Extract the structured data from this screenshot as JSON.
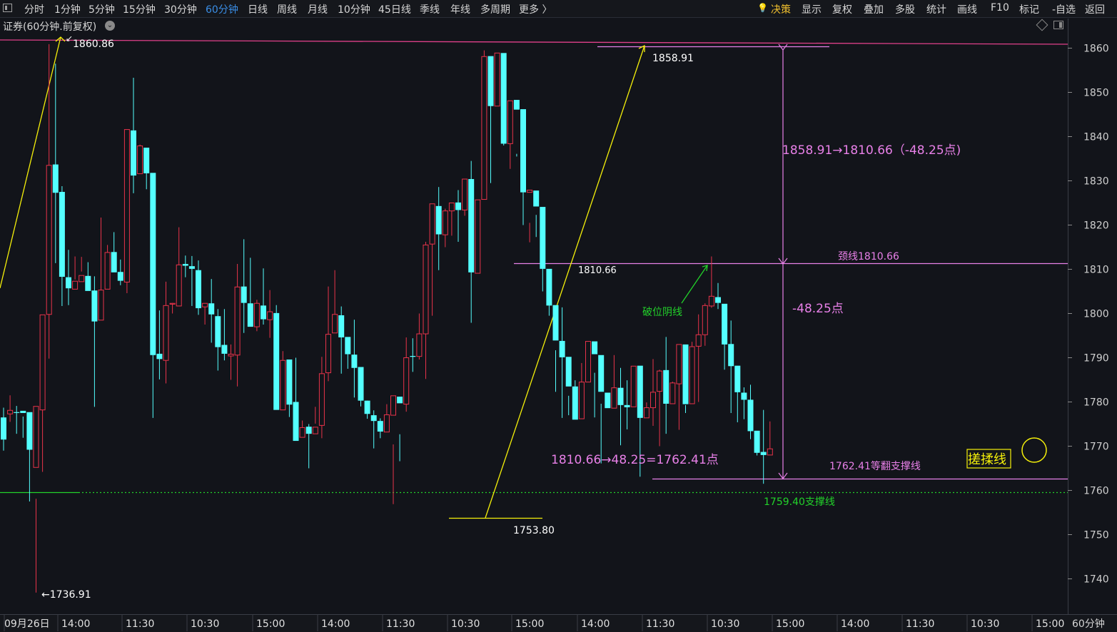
{
  "toolbar": {
    "periods": [
      "分时",
      "1分钟",
      "5分钟",
      "15分钟",
      "30分钟",
      "60分钟",
      "日线",
      "周线",
      "月线",
      "10分钟",
      "45日线",
      "季线",
      "年线",
      "多周期",
      "更多 〉"
    ],
    "active_period": "60分钟",
    "right_items": [
      "决策",
      "显示",
      "复权",
      "叠加",
      "多股",
      "统计",
      "画线",
      "F10",
      "标记",
      "-自选",
      "返回"
    ]
  },
  "subtitle": "证券(60分钟.前复权)",
  "chart_data": {
    "type": "candlestick",
    "ylim": [
      1734,
      1865
    ],
    "yticks": [
      1740,
      1750,
      1760,
      1770,
      1780,
      1790,
      1800,
      1810,
      1820,
      1830,
      1840,
      1850,
      1860
    ],
    "xticks": [
      "09月26日",
      "14:00",
      "11:30",
      "10:30",
      "15:00",
      "14:00",
      "11:30",
      "10:30",
      "15:00",
      "14:00",
      "11:30",
      "10:30",
      "15:00",
      "14:00",
      "11:30",
      "10:30",
      "15:00"
    ],
    "period_label": "60分钟",
    "up_color": "#e8334a",
    "down_color": "#54ffff",
    "candles": [
      [
        1776.5,
        1771.5,
        1778.7,
        1769.0
      ],
      [
        1777.3,
        1778.1,
        1781.5,
        1775.5
      ],
      [
        1777.7,
        1777.6,
        1779.1,
        1772.8
      ],
      [
        1778.0,
        1777.5,
        1776.7,
        1771.9
      ],
      [
        1777.7,
        1769.2,
        1777.0,
        1757.5
      ],
      [
        1765.2,
        1779.0,
        1736.9,
        1758.1
      ],
      [
        1778.2,
        1799.7,
        1764.2,
        1789.3
      ],
      [
        1799.8,
        1833.5,
        1789.8,
        1860.9
      ],
      [
        1833.7,
        1827.3,
        1811.4,
        1856.5
      ],
      [
        1827.5,
        1808.3,
        1801.7,
        1828.8
      ],
      [
        1808.2,
        1805.7,
        1801.9,
        1814.4
      ],
      [
        1805.5,
        1807.3,
        1807.7,
        1812.9
      ],
      [
        1807.2,
        1808.6,
        1809.5,
        1812.8
      ],
      [
        1808.5,
        1805.1,
        1806.1,
        1811.6
      ],
      [
        1805.2,
        1798.2,
        1778.9,
        1808.4
      ],
      [
        1798.5,
        1805.3,
        1804.4,
        1821.7
      ],
      [
        1805.5,
        1813.8,
        1810.9,
        1815.5
      ],
      [
        1813.9,
        1809.3,
        1809.8,
        1818.4
      ],
      [
        1809.4,
        1807.4,
        1806.4,
        1812.2
      ],
      [
        1807.1,
        1841.6,
        1804.6,
        1839.7
      ],
      [
        1841.4,
        1831.2,
        1827.2,
        1853.3
      ],
      [
        1831.6,
        1837.9,
        1831.7,
        1838.2
      ],
      [
        1837.5,
        1831.7,
        1828.1,
        1836.2
      ],
      [
        1831.8,
        1790.6,
        1776.4,
        1822.7
      ],
      [
        1790.9,
        1789.7,
        1785.1,
        1800.7
      ],
      [
        1789.4,
        1801.8,
        1784.2,
        1807.2
      ],
      [
        1802.3,
        1802.3,
        1800.0,
        1802.4
      ],
      [
        1801.7,
        1811.0,
        1804.2,
        1819.5
      ],
      [
        1811.2,
        1810.8,
        1808.2,
        1813.1
      ],
      [
        1810.7,
        1810.1,
        1801.7,
        1813.0
      ],
      [
        1809.8,
        1801.2,
        1799.7,
        1812.0
      ],
      [
        1801.5,
        1802.3,
        1797.5,
        1801.9
      ],
      [
        1802.3,
        1799.8,
        1793.4,
        1807.8
      ],
      [
        1799.4,
        1792.4,
        1787.1,
        1801.0
      ],
      [
        1792.9,
        1790.9,
        1789.4,
        1801.0
      ],
      [
        1790.4,
        1790.8,
        1785.0,
        1793.0
      ],
      [
        1790.6,
        1806.0,
        1783.5,
        1811.2
      ],
      [
        1806.1,
        1802.4,
        1795.6,
        1816.8
      ],
      [
        1802.3,
        1797.0,
        1797.4,
        1812.6
      ],
      [
        1797.0,
        1802.3,
        1796.0,
        1803.1
      ],
      [
        1801.8,
        1798.7,
        1797.5,
        1810.2
      ],
      [
        1798.6,
        1800.4,
        1794.5,
        1805.3
      ],
      [
        1800.1,
        1778.2,
        1784.4,
        1801.9
      ],
      [
        1778.2,
        1789.4,
        1783.6,
        1791.5
      ],
      [
        1789.6,
        1779.4,
        1776.6,
        1788.0
      ],
      [
        1780.0,
        1771.2,
        1771.9,
        1790.0
      ],
      [
        1772.0,
        1774.2,
        1773.3,
        1775.8
      ],
      [
        1774.4,
        1772.8,
        1775.0,
        1765.0
      ],
      [
        1772.8,
        1774.3,
        1775.1,
        1778.9
      ],
      [
        1774.7,
        1786.4,
        1771.8,
        1790.2
      ],
      [
        1786.6,
        1795.3,
        1784.7,
        1806.1
      ],
      [
        1795.6,
        1799.8,
        1798.3,
        1809.8
      ],
      [
        1799.6,
        1794.6,
        1786.4,
        1801.6
      ],
      [
        1794.7,
        1790.8,
        1787.5,
        1792.7
      ],
      [
        1790.7,
        1787.7,
        1781.0,
        1798.6
      ],
      [
        1787.9,
        1780.3,
        1779.0,
        1783.0
      ],
      [
        1780.3,
        1777.3,
        1776.2,
        1780.3
      ],
      [
        1777.0,
        1775.7,
        1769.5,
        1778.1
      ],
      [
        1775.7,
        1773.3,
        1771.8,
        1776.3
      ],
      [
        1773.2,
        1777.1,
        1774.3,
        1779.5
      ],
      [
        1777.0,
        1781.4,
        1756.9,
        1770.4
      ],
      [
        1781.2,
        1779.7,
        1766.6,
        1772.7
      ],
      [
        1779.5,
        1790.0,
        1777.8,
        1794.6
      ],
      [
        1790.4,
        1790.2,
        1786.8,
        1794.4
      ],
      [
        1790.3,
        1795.4,
        1789.6,
        1800.0
      ],
      [
        1795.4,
        1815.5,
        1785.2,
        1816.2
      ],
      [
        1815.7,
        1824.8,
        1799.5,
        1822.8
      ],
      [
        1824.3,
        1817.9,
        1809.8,
        1828.6
      ],
      [
        1817.8,
        1823.2,
        1815.0,
        1823.7
      ],
      [
        1823.2,
        1825.0,
        1817.6,
        1825.0
      ],
      [
        1825.1,
        1823.4,
        1816.2,
        1827.9
      ],
      [
        1823.4,
        1830.4,
        1822.1,
        1829.0
      ],
      [
        1830.4,
        1809.3,
        1797.9,
        1834.5
      ],
      [
        1809.1,
        1825.7,
        1810.7,
        1824.7
      ],
      [
        1825.8,
        1858.1,
        1859.5,
        1835.8
      ],
      [
        1858.2,
        1846.9,
        1829.5,
        1849.6
      ],
      [
        1846.9,
        1858.9,
        1858.9,
        1855.2
      ],
      [
        1858.9,
        1838.4,
        1838.0,
        1857.0
      ],
      [
        1838.4,
        1848.1,
        1847.0,
        1832.7
      ],
      [
        1848.3,
        1846.1,
        1835.5,
        1836.1
      ],
      [
        1846.2,
        1827.4,
        1820.0,
        1843.1
      ],
      [
        1827.4,
        1827.9,
        1820.5,
        1816.1
      ],
      [
        1827.8,
        1824.2,
        1822.3,
        1817.3
      ],
      [
        1824.1,
        1810.1,
        1805.0,
        1812.0
      ],
      [
        1810.1,
        1801.8,
        1799.5,
        1807.2
      ],
      [
        1801.9,
        1793.9,
        1782.3,
        1791.7
      ],
      [
        1793.8,
        1790.1,
        1776.4,
        1801.4
      ],
      [
        1790.2,
        1783.5,
        1781.4,
        1777.0
      ],
      [
        1783.5,
        1776.0,
        1776.6,
        1784.9
      ],
      [
        1776.2,
        1784.5,
        1779.6,
        1788.8
      ],
      [
        1784.5,
        1793.7,
        1785.6,
        1793.4
      ],
      [
        1793.7,
        1790.8,
        1776.5,
        1786.6
      ],
      [
        1790.6,
        1782.3,
        1766.1,
        1779.6
      ],
      [
        1782.1,
        1778.6,
        1780.1,
        1781.1
      ],
      [
        1778.6,
        1783.2,
        1779.4,
        1790.6
      ],
      [
        1783.2,
        1779.3,
        1770.2,
        1787.7
      ],
      [
        1779.3,
        1778.8,
        1773.8,
        1784.9
      ],
      [
        1778.9,
        1788.1,
        1780.3,
        1788.1
      ],
      [
        1788.2,
        1776.4,
        1763.1,
        1783.2
      ],
      [
        1776.4,
        1778.7,
        1778.2,
        1779.9
      ],
      [
        1778.7,
        1782.2,
        1774.6,
        1789.7
      ],
      [
        1782.4,
        1787.0,
        1770.0,
        1787.3
      ],
      [
        1787.2,
        1779.6,
        1772.8,
        1794.7
      ],
      [
        1779.6,
        1784.3,
        1782.1,
        1784.6
      ],
      [
        1784.1,
        1793.0,
        1773.7,
        1791.5
      ],
      [
        1793.0,
        1779.5,
        1777.5,
        1779.3
      ],
      [
        1779.6,
        1792.5,
        1787.7,
        1793.6
      ],
      [
        1792.6,
        1795.2,
        1780.0,
        1799.8
      ],
      [
        1795.2,
        1801.8,
        1792.7,
        1802.3
      ],
      [
        1801.7,
        1803.9,
        1801.3,
        1812.9
      ],
      [
        1803.7,
        1802.4,
        1801.0,
        1806.9
      ],
      [
        1802.2,
        1793.0,
        1787.3,
        1798.2
      ],
      [
        1793.1,
        1788.1,
        1777.5,
        1798.4
      ],
      [
        1788.2,
        1782.2,
        1775.4,
        1788.0
      ],
      [
        1782.1,
        1780.5,
        1776.1,
        1783.3
      ],
      [
        1780.5,
        1773.4,
        1771.6,
        1783.9
      ],
      [
        1773.5,
        1768.5,
        1767.9,
        1768.8
      ],
      [
        1768.7,
        1768.0,
        1761.5,
        1778.2
      ],
      [
        1768.0,
        1769.4,
        1769.1,
        1775.6
      ]
    ],
    "annotations": {
      "swing_high_left": "1860.86",
      "swing_low_left": "1736.91",
      "swing_low_mid": "1753.80",
      "swing_high_right": "1858.91",
      "neckline_point": "1810.66",
      "drop_text": "1858.91→1810.66（-48.25点)",
      "neckline_label": "颈线1810.66",
      "drop_points": "-48.25点",
      "breakdown_label": "破位阴线",
      "calc_text": "1810.66→48.25=1762.41点",
      "target_label": "1762.41等翻支撑线",
      "support_label": "1759.40支撑线",
      "candle_label": "搓揉线"
    }
  }
}
